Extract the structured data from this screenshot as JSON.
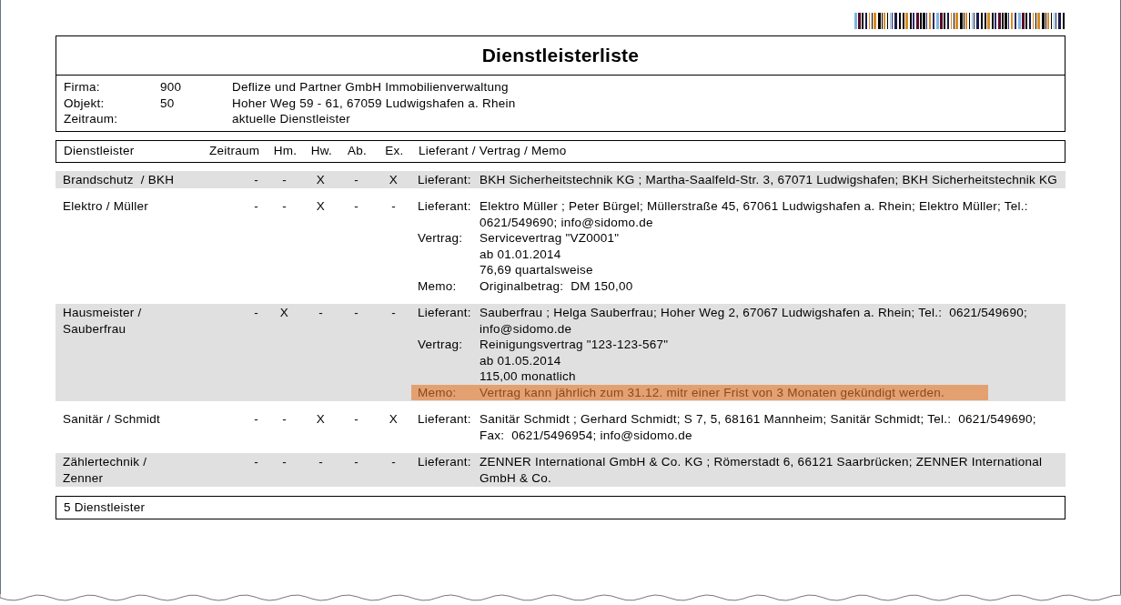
{
  "title": "Dienstleisterliste",
  "info": [
    {
      "label": "Firma:",
      "code": "900",
      "value": "Deflize und Partner GmbH Immobilienverwaltung"
    },
    {
      "label": "Objekt:",
      "code": "50",
      "value": "Hoher Weg 59 - 61, 67059 Ludwigshafen a. Rhein"
    },
    {
      "label": "Zeitraum:",
      "value": "aktuelle Dienstleister"
    }
  ],
  "columns": [
    "Dienstleister",
    "Zeitraum",
    "Hm.",
    "Hw.",
    "Ab.",
    "Ex.",
    "Lieferant / Vertrag / Memo"
  ],
  "rows": [
    {
      "name": "Brandschutz  / BKH",
      "flags": [
        "-",
        "-",
        "X",
        "-",
        "X"
      ],
      "entries": [
        {
          "label": "Lieferant:",
          "highlighted": false,
          "lines": [
            "BKH Sicherheitstechnik KG ; Martha-Saalfeld-Str. 3, 67071 Ludwigshafen; BKH Sicherheitstechnik KG"
          ]
        }
      ]
    },
    {
      "name": "Elektro / Müller",
      "flags": [
        "-",
        "-",
        "X",
        "-",
        "-"
      ],
      "entries": [
        {
          "label": "Lieferant:",
          "highlighted": false,
          "lines": [
            "Elektro Müller ; Peter Bürgel; Müllerstraße 45, 67061 Ludwigshafen a. Rhein; Elektro Müller; Tel.: 0621/549690; info@sidomo.de"
          ]
        },
        {
          "label": "Vertrag:",
          "highlighted": false,
          "lines": [
            "Servicevertrag \"VZ0001\"",
            "ab 01.01.2014",
            "76,69 quartalsweise"
          ]
        },
        {
          "label": "Memo:",
          "highlighted": false,
          "lines": [
            "Originalbetrag:  DM 150,00"
          ]
        }
      ]
    },
    {
      "name": "Hausmeister / Sauberfrau",
      "flags": [
        "-",
        "X",
        "-",
        "-",
        "-"
      ],
      "entries": [
        {
          "label": "Lieferant:",
          "highlighted": false,
          "lines": [
            "Sauberfrau ; Helga Sauberfrau; Hoher Weg 2, 67067 Ludwigshafen a. Rhein; Tel.:  0621/549690; info@sidomo.de"
          ]
        },
        {
          "label": "Vertrag:",
          "highlighted": false,
          "lines": [
            "Reinigungsvertrag \"123-123-567\"",
            "ab 01.05.2014",
            "115,00 monatlich"
          ]
        },
        {
          "label": "Memo:",
          "highlighted": true,
          "lines": [
            "Vertrag kann jährlich zum 31.12. mitr einer Frist von 3 Monaten gekündigt werden."
          ]
        }
      ]
    },
    {
      "name": "Sanitär / Schmidt",
      "flags": [
        "-",
        "-",
        "X",
        "-",
        "X"
      ],
      "entries": [
        {
          "label": "Lieferant:",
          "highlighted": false,
          "lines": [
            "Sanitär Schmidt ; Gerhard Schmidt; S 7, 5, 68161 Mannheim; Sanitär Schmidt; Tel.:  0621/549690; Fax:  0621/5496954; info@sidomo.de"
          ]
        }
      ]
    },
    {
      "name": "Zählertechnik / Zenner",
      "flags": [
        "-",
        "-",
        "-",
        "-",
        "-"
      ],
      "entries": [
        {
          "label": "Lieferant:",
          "highlighted": false,
          "lines": [
            "ZENNER International GmbH & Co. KG ; Römerstadt 6, 66121 Saarbrücken; ZENNER International GmbH & Co."
          ]
        }
      ]
    }
  ],
  "footer": "5 Dienstleister"
}
